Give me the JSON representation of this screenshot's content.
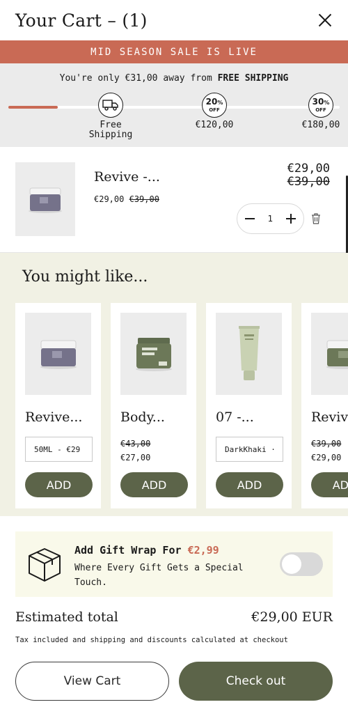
{
  "header": {
    "title": "Your Cart – (1)"
  },
  "banner": {
    "text": "MID SEASON SALE IS LIVE"
  },
  "shipping": {
    "msg_prefix": "You're only €31,00 away from ",
    "msg_bold": "FREE SHIPPING",
    "progress_fraction": 0.15,
    "milestones": [
      {
        "label_line1": "Free",
        "label_line2": "Shipping",
        "icon": "truck-icon"
      },
      {
        "pct": "20",
        "pct_sign": "%",
        "off": "OFF",
        "label": "€120,00"
      },
      {
        "pct": "30",
        "pct_sign": "%",
        "off": "OFF",
        "label": "€180,00"
      }
    ]
  },
  "cart": {
    "item": {
      "title": "Revive -...",
      "price": "€29,00",
      "compare_price": "€39,00",
      "total": "€29,00",
      "total_compare": "€39,00",
      "quantity": "1"
    }
  },
  "recommendations": {
    "heading": "You might like...",
    "cards": [
      {
        "title": "Revive...",
        "select": "50ML - €29",
        "add": "ADD"
      },
      {
        "title": "Body...",
        "compare_price": "€43,00",
        "price": "€27,00",
        "add": "ADD"
      },
      {
        "title": "07 -...",
        "select": "DarkKhaki ·",
        "add": "ADD"
      },
      {
        "title": "Revive",
        "compare_price": "€39,00",
        "price": "€29,00",
        "add": "ADD"
      }
    ]
  },
  "gift_wrap": {
    "title": "Add Gift Wrap For ",
    "price": "€2,99",
    "subtitle": "Where Every Gift Gets a Special Touch.",
    "enabled": false
  },
  "totals": {
    "label": "Estimated total",
    "value": "€29,00 EUR",
    "tax_note": "Tax included and shipping and discounts calculated at checkout"
  },
  "actions": {
    "view_cart": "View Cart",
    "checkout": "Check out"
  },
  "colors": {
    "accent": "#c96a55",
    "olive": "#5c6449",
    "cream": "#f1f1e4"
  }
}
